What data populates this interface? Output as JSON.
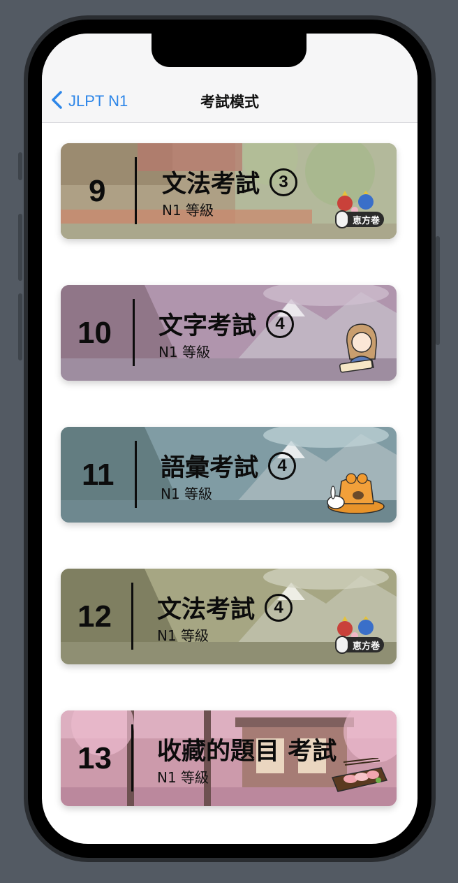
{
  "nav": {
    "back_label": "JLPT N1",
    "title": "考試模式"
  },
  "cards": [
    {
      "number": "9",
      "title": "文法考試",
      "badge": "3",
      "level": "N1 等級",
      "sticker": "ehoumaki-sticker",
      "sticker_text": "恵方巻"
    },
    {
      "number": "10",
      "title": "文字考試",
      "badge": "4",
      "level": "N1 等級",
      "sticker": "studying-girl-sticker"
    },
    {
      "number": "11",
      "title": "語彙考試",
      "badge": "4",
      "level": "N1 等級",
      "sticker": "kagami-mochi-rabbit-sticker"
    },
    {
      "number": "12",
      "title": "文法考試",
      "badge": "4",
      "level": "N1 等級",
      "sticker": "ehoumaki-sticker",
      "sticker_text": "恵方巻"
    },
    {
      "number": "13",
      "title": "收藏的題目 考試",
      "badge": "",
      "level": "N1 等級",
      "sticker": "sashimi-plate-sticker"
    }
  ],
  "colors": {
    "accent": "#2d86e8",
    "card9_bg": "#8f7a52",
    "card10_bg": "#a3839f",
    "card11_bg": "#6f8f98",
    "card12_bg": "#9a9a72",
    "card13_bg": "#c58ca0"
  }
}
